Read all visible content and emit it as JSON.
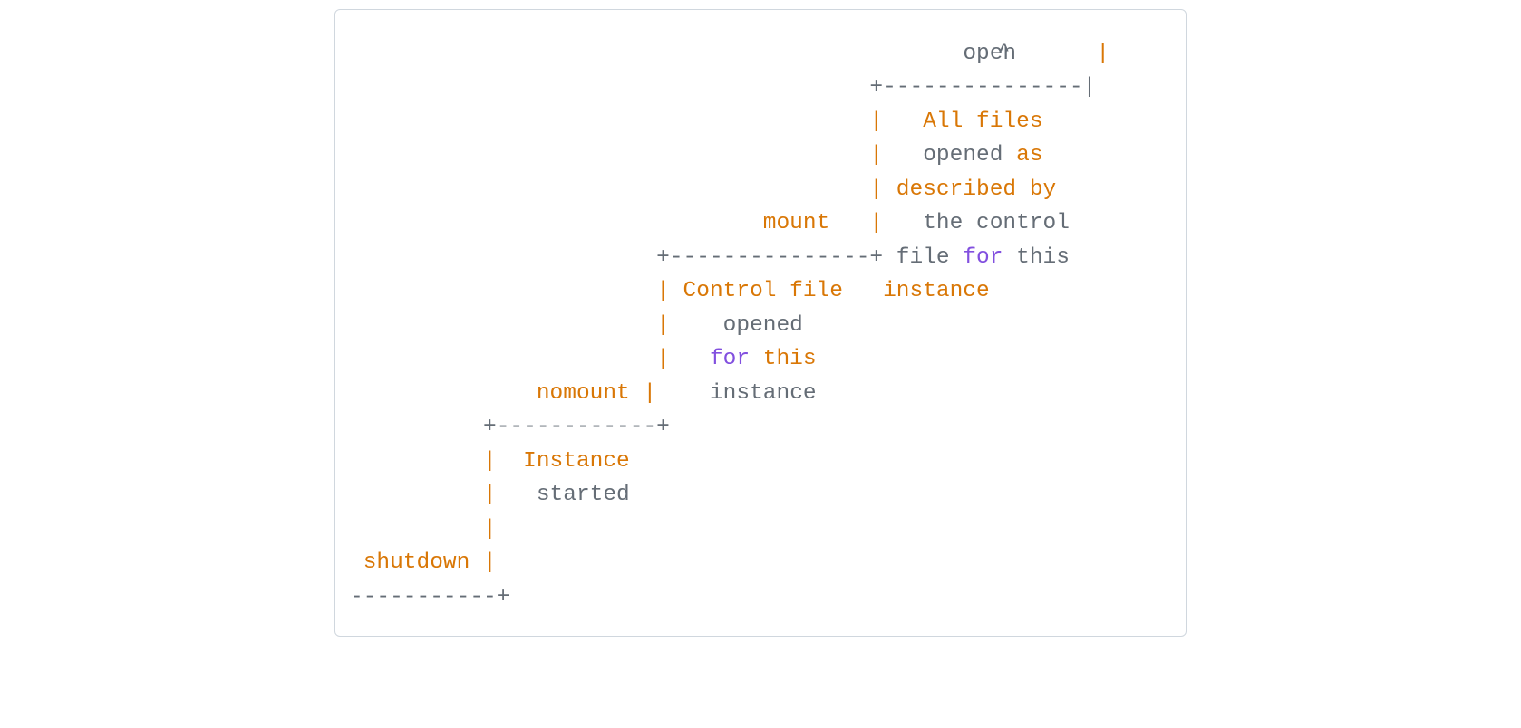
{
  "caret": "^",
  "code": {
    "lines": [
      [
        {
          "t": "                                              ",
          "c": "gray"
        },
        {
          "t": "open",
          "c": "gray"
        },
        {
          "t": "      |",
          "c": "orange"
        }
      ],
      [
        {
          "t": "                                       +---------------|",
          "c": "gray"
        }
      ],
      [
        {
          "t": "                                       ",
          "c": "gray"
        },
        {
          "t": "|   All files",
          "c": "orange"
        }
      ],
      [
        {
          "t": "                                       ",
          "c": "gray"
        },
        {
          "t": "|",
          "c": "orange"
        },
        {
          "t": "   opened ",
          "c": "gray"
        },
        {
          "t": "as",
          "c": "orange"
        }
      ],
      [
        {
          "t": "                                       ",
          "c": "gray"
        },
        {
          "t": "| described by",
          "c": "orange"
        }
      ],
      [
        {
          "t": "                               ",
          "c": "gray"
        },
        {
          "t": "mount",
          "c": "orange"
        },
        {
          "t": "   ",
          "c": "gray"
        },
        {
          "t": "|",
          "c": "orange"
        },
        {
          "t": "   the control",
          "c": "gray"
        }
      ],
      [
        {
          "t": "                       +---------------+ file ",
          "c": "gray"
        },
        {
          "t": "for",
          "c": "purple"
        },
        {
          "t": " this",
          "c": "gray"
        }
      ],
      [
        {
          "t": "                       ",
          "c": "gray"
        },
        {
          "t": "| Control file   instance",
          "c": "orange"
        }
      ],
      [
        {
          "t": "                       ",
          "c": "gray"
        },
        {
          "t": "|",
          "c": "orange"
        },
        {
          "t": "    opened",
          "c": "gray"
        }
      ],
      [
        {
          "t": "                       ",
          "c": "gray"
        },
        {
          "t": "|",
          "c": "orange"
        },
        {
          "t": "   ",
          "c": "gray"
        },
        {
          "t": "for",
          "c": "purple"
        },
        {
          "t": " ",
          "c": "gray"
        },
        {
          "t": "this",
          "c": "orange"
        }
      ],
      [
        {
          "t": "              ",
          "c": "gray"
        },
        {
          "t": "nomount |",
          "c": "orange"
        },
        {
          "t": "    instance",
          "c": "gray"
        }
      ],
      [
        {
          "t": "          +------------+",
          "c": "gray"
        }
      ],
      [
        {
          "t": "          ",
          "c": "gray"
        },
        {
          "t": "|  Instance",
          "c": "orange"
        }
      ],
      [
        {
          "t": "          ",
          "c": "gray"
        },
        {
          "t": "|",
          "c": "orange"
        },
        {
          "t": "   started",
          "c": "gray"
        }
      ],
      [
        {
          "t": "          ",
          "c": "gray"
        },
        {
          "t": "|",
          "c": "orange"
        }
      ],
      [
        {
          "t": " ",
          "c": "gray"
        },
        {
          "t": "shutdown",
          "c": "orange"
        },
        {
          "t": " ",
          "c": "gray"
        },
        {
          "t": "|",
          "c": "orange"
        }
      ],
      [
        {
          "t": "-----------+",
          "c": "gray"
        }
      ]
    ]
  }
}
